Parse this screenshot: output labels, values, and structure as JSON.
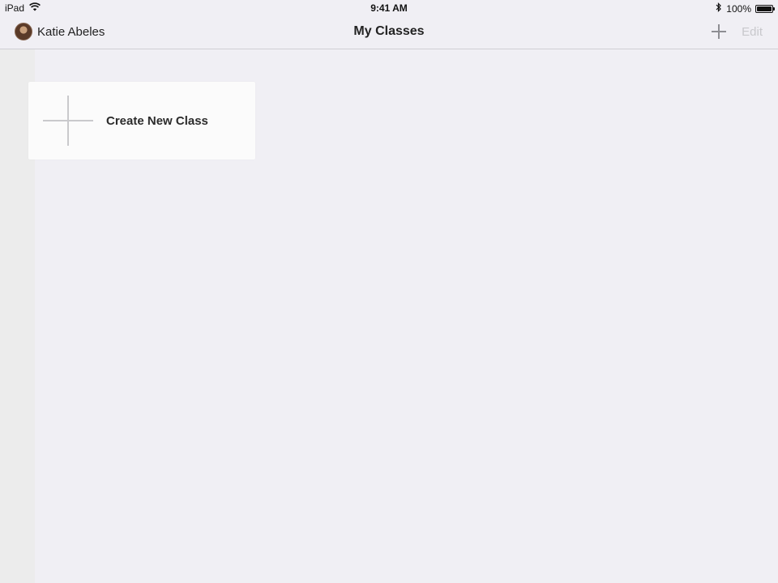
{
  "status_bar": {
    "device": "iPad",
    "time": "9:41 AM",
    "battery_text": "100%",
    "battery_level": 1.0,
    "icons": [
      "wifi-icon",
      "bluetooth-icon",
      "battery-icon"
    ]
  },
  "nav_bar": {
    "user_name": "Katie Abeles",
    "title": "My Classes",
    "add_icon": "plus-icon",
    "edit_label": "Edit"
  },
  "main": {
    "create_card": {
      "label": "Create New Class",
      "icon": "plus-icon"
    }
  },
  "colors": {
    "background": "#f0eff4",
    "card": "#fbfbfb",
    "edit_disabled": "#c8c8cc",
    "plus_gray": "#8e8e93"
  }
}
